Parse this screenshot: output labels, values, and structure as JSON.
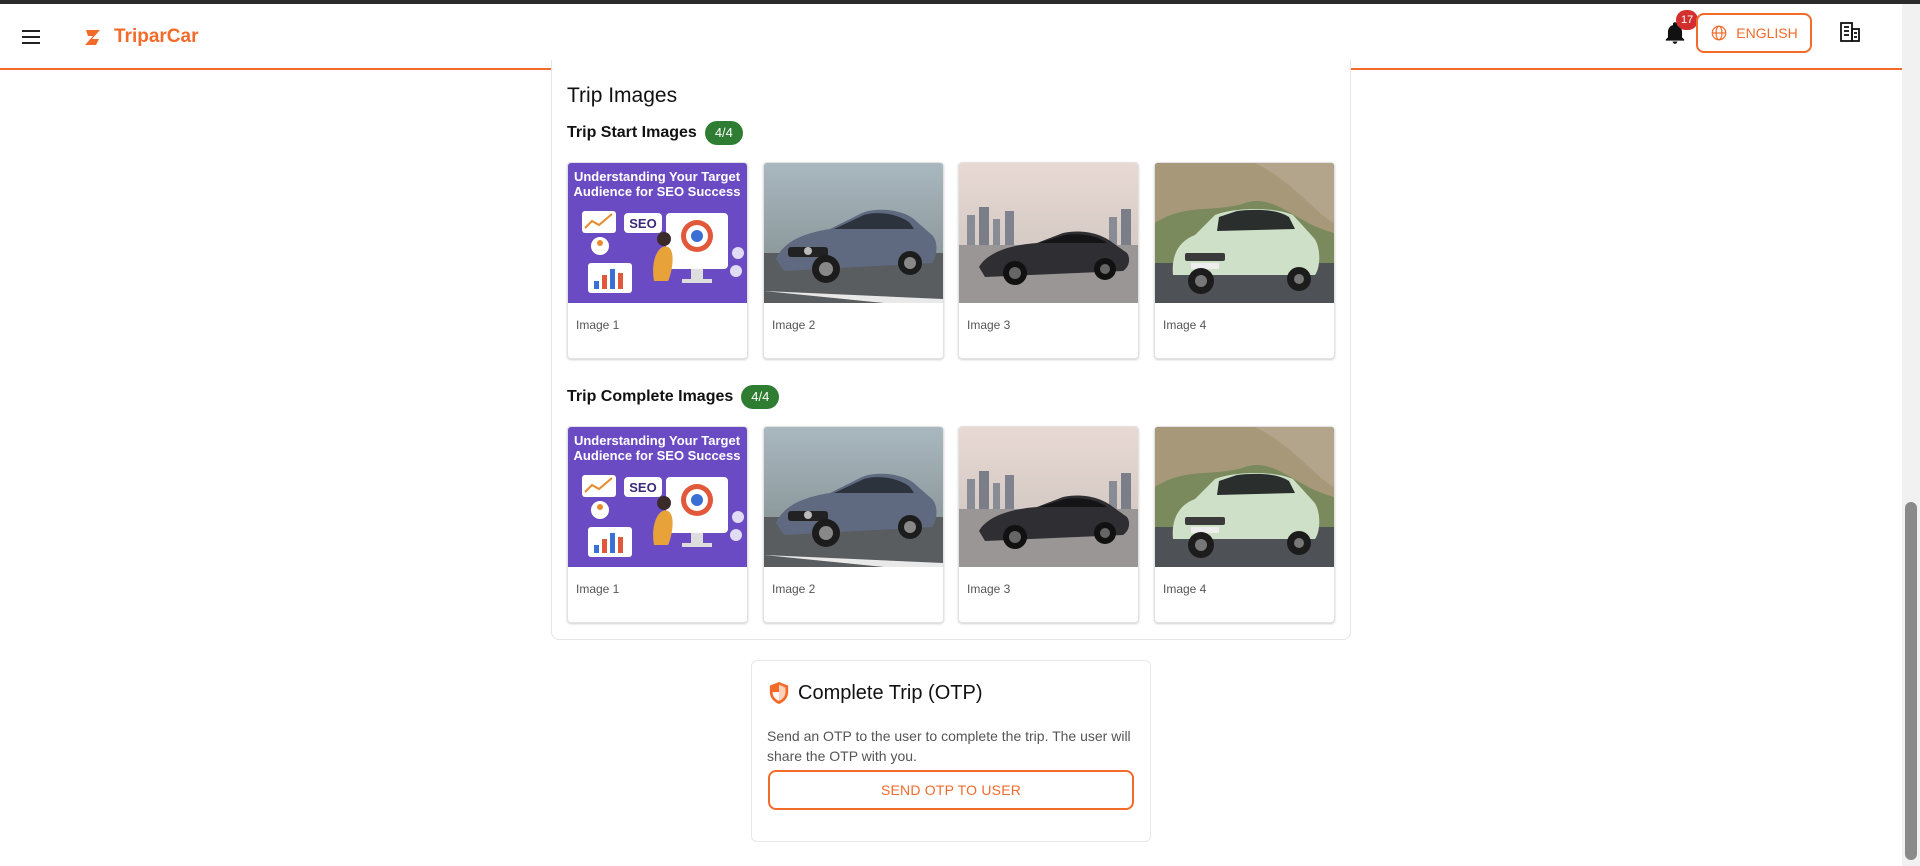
{
  "app": {
    "name": "TriparCar",
    "brand_color": "#f26b2a"
  },
  "header": {
    "notification_count": "17",
    "language_label": "ENGLISH"
  },
  "trip_images": {
    "title": "Trip Images",
    "start": {
      "title": "Trip Start Images",
      "count": "4/4",
      "images": [
        {
          "caption": "Image 1",
          "kind": "seo-banner",
          "banner_line1": "Understanding Your Target",
          "banner_line2": "Audience for SEO Success",
          "banner_tag": "SEO"
        },
        {
          "caption": "Image 2",
          "kind": "grey-sedan"
        },
        {
          "caption": "Image 3",
          "kind": "dark-coupe"
        },
        {
          "caption": "Image 4",
          "kind": "mint-suv"
        }
      ]
    },
    "complete": {
      "title": "Trip Complete Images",
      "count": "4/4",
      "images": [
        {
          "caption": "Image 1",
          "kind": "seo-banner",
          "banner_line1": "Understanding Your Target",
          "banner_line2": "Audience for SEO Success",
          "banner_tag": "SEO"
        },
        {
          "caption": "Image 2",
          "kind": "grey-sedan"
        },
        {
          "caption": "Image 3",
          "kind": "dark-coupe"
        },
        {
          "caption": "Image 4",
          "kind": "mint-suv"
        }
      ]
    }
  },
  "otp": {
    "title": "Complete Trip (OTP)",
    "description": "Send an OTP to the user to complete the trip. The user will share the OTP with you.",
    "button_label": "SEND OTP TO USER"
  },
  "colors": {
    "badge_green": "#2e7d32",
    "badge_red": "#d32f2f",
    "accent": "#f26b2a"
  }
}
